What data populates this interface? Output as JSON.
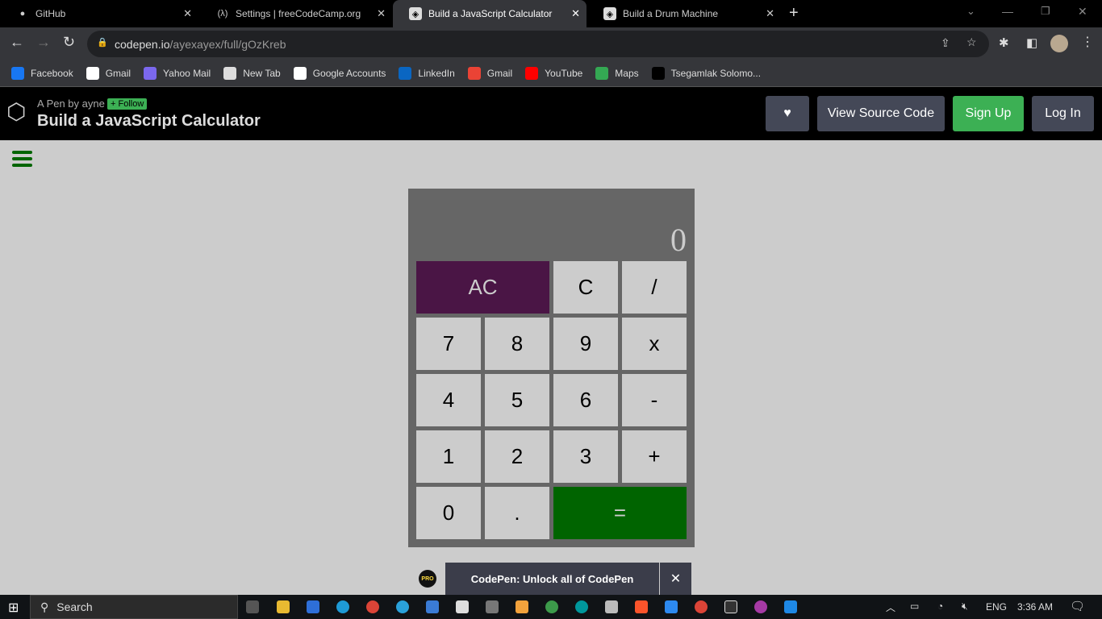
{
  "browser": {
    "tabs": [
      {
        "title": "GitHub",
        "icon": "github-icon"
      },
      {
        "title": "Settings | freeCodeCamp.org",
        "icon": "freecodecamp-icon"
      },
      {
        "title": "Build a JavaScript Calculator",
        "icon": "codepen-icon",
        "active": true
      },
      {
        "title": "Build a Drum Machine",
        "icon": "codepen-icon"
      }
    ],
    "url_host": "codepen.io",
    "url_path": "/ayexayex/full/gOzKreb",
    "bookmarks": [
      {
        "label": "Facebook",
        "color": "#1877f2"
      },
      {
        "label": "Gmail",
        "color": "#fff"
      },
      {
        "label": "Yahoo Mail",
        "color": "#7b68ee"
      },
      {
        "label": "New Tab",
        "color": "#ddd"
      },
      {
        "label": "Google Accounts",
        "color": "#fff"
      },
      {
        "label": "LinkedIn",
        "color": "#0a66c2"
      },
      {
        "label": "Gmail",
        "color": "#ea4335"
      },
      {
        "label": "YouTube",
        "color": "#ff0000"
      },
      {
        "label": "Maps",
        "color": "#34a853"
      },
      {
        "label": "Tsegamlak Solomo...",
        "color": "#000"
      }
    ]
  },
  "codepen": {
    "byline": "A Pen by ayne",
    "follow": "+ Follow",
    "title": "Build a JavaScript Calculator",
    "view_source": "View Source Code",
    "sign_up": "Sign Up",
    "log_in": "Log In"
  },
  "calculator": {
    "display": "0",
    "keys": {
      "clear_all": "AC",
      "clear": "C",
      "divide": "/",
      "seven": "7",
      "eight": "8",
      "nine": "9",
      "multiply": "x",
      "four": "4",
      "five": "5",
      "six": "6",
      "subtract": "-",
      "one": "1",
      "two": "2",
      "three": "3",
      "add": "+",
      "zero": "0",
      "decimal": ".",
      "equals": "="
    },
    "colors": {
      "ac": "#4a1545",
      "equals": "#006400",
      "body": "#666666"
    }
  },
  "banner": {
    "text": "CodePen: Unlock all of CodePen",
    "badge": "PRO"
  },
  "taskbar": {
    "search": "Search",
    "lang": "ENG",
    "time": "3:36 AM"
  }
}
